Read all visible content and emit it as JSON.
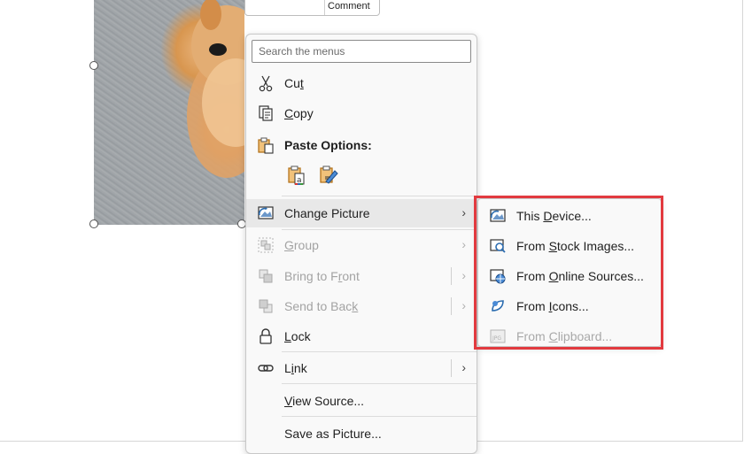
{
  "mini_toolbar": {
    "comment_label": "Comment"
  },
  "context_menu": {
    "search_placeholder": "Search the menus",
    "cut": {
      "pre": "Cu",
      "key": "t",
      "post": ""
    },
    "copy": {
      "pre": "",
      "key": "C",
      "post": "opy"
    },
    "paste_options": "Paste Options:",
    "change_picture": {
      "pre": "Chan",
      "key": "g",
      "post": "e Picture"
    },
    "group": {
      "pre": "",
      "key": "G",
      "post": "roup"
    },
    "bring_to_front": {
      "pre": "Bring to F",
      "key": "r",
      "post": "ont"
    },
    "send_to_back": {
      "pre": "Send to Bac",
      "key": "k",
      "post": ""
    },
    "lock": {
      "pre": "",
      "key": "L",
      "post": "ock"
    },
    "link": {
      "pre": "L",
      "key": "i",
      "post": "nk"
    },
    "view_source": {
      "pre": "",
      "key": "V",
      "post": "iew Source..."
    },
    "save_as_picture": {
      "pre": "Save as Picture",
      "key": "",
      "post": "..."
    }
  },
  "submenu": {
    "this_device": {
      "pre": "This ",
      "key": "D",
      "post": "evice..."
    },
    "stock_images": {
      "pre": "From ",
      "key": "S",
      "post": "tock Images..."
    },
    "online_sources": {
      "pre": "From ",
      "key": "O",
      "post": "nline Sources..."
    },
    "icons": {
      "pre": "From ",
      "key": "I",
      "post": "cons..."
    },
    "clipboard": {
      "pre": "From ",
      "key": "C",
      "post": "lipboard..."
    }
  },
  "colors": {
    "highlight": "#e23a3f",
    "icon_blue": "#2b6cb0",
    "icon_orange": "#e08a1e"
  },
  "icons": [
    "scissors-icon",
    "copy-icon",
    "paste-icon",
    "keep-formatting-icon",
    "picture-only-icon",
    "change-picture-icon",
    "group-icon",
    "bring-front-icon",
    "send-back-icon",
    "lock-icon",
    "link-icon",
    "device-icon",
    "stock-images-icon",
    "online-sources-icon",
    "icons-icon",
    "clipboard-icon"
  ]
}
